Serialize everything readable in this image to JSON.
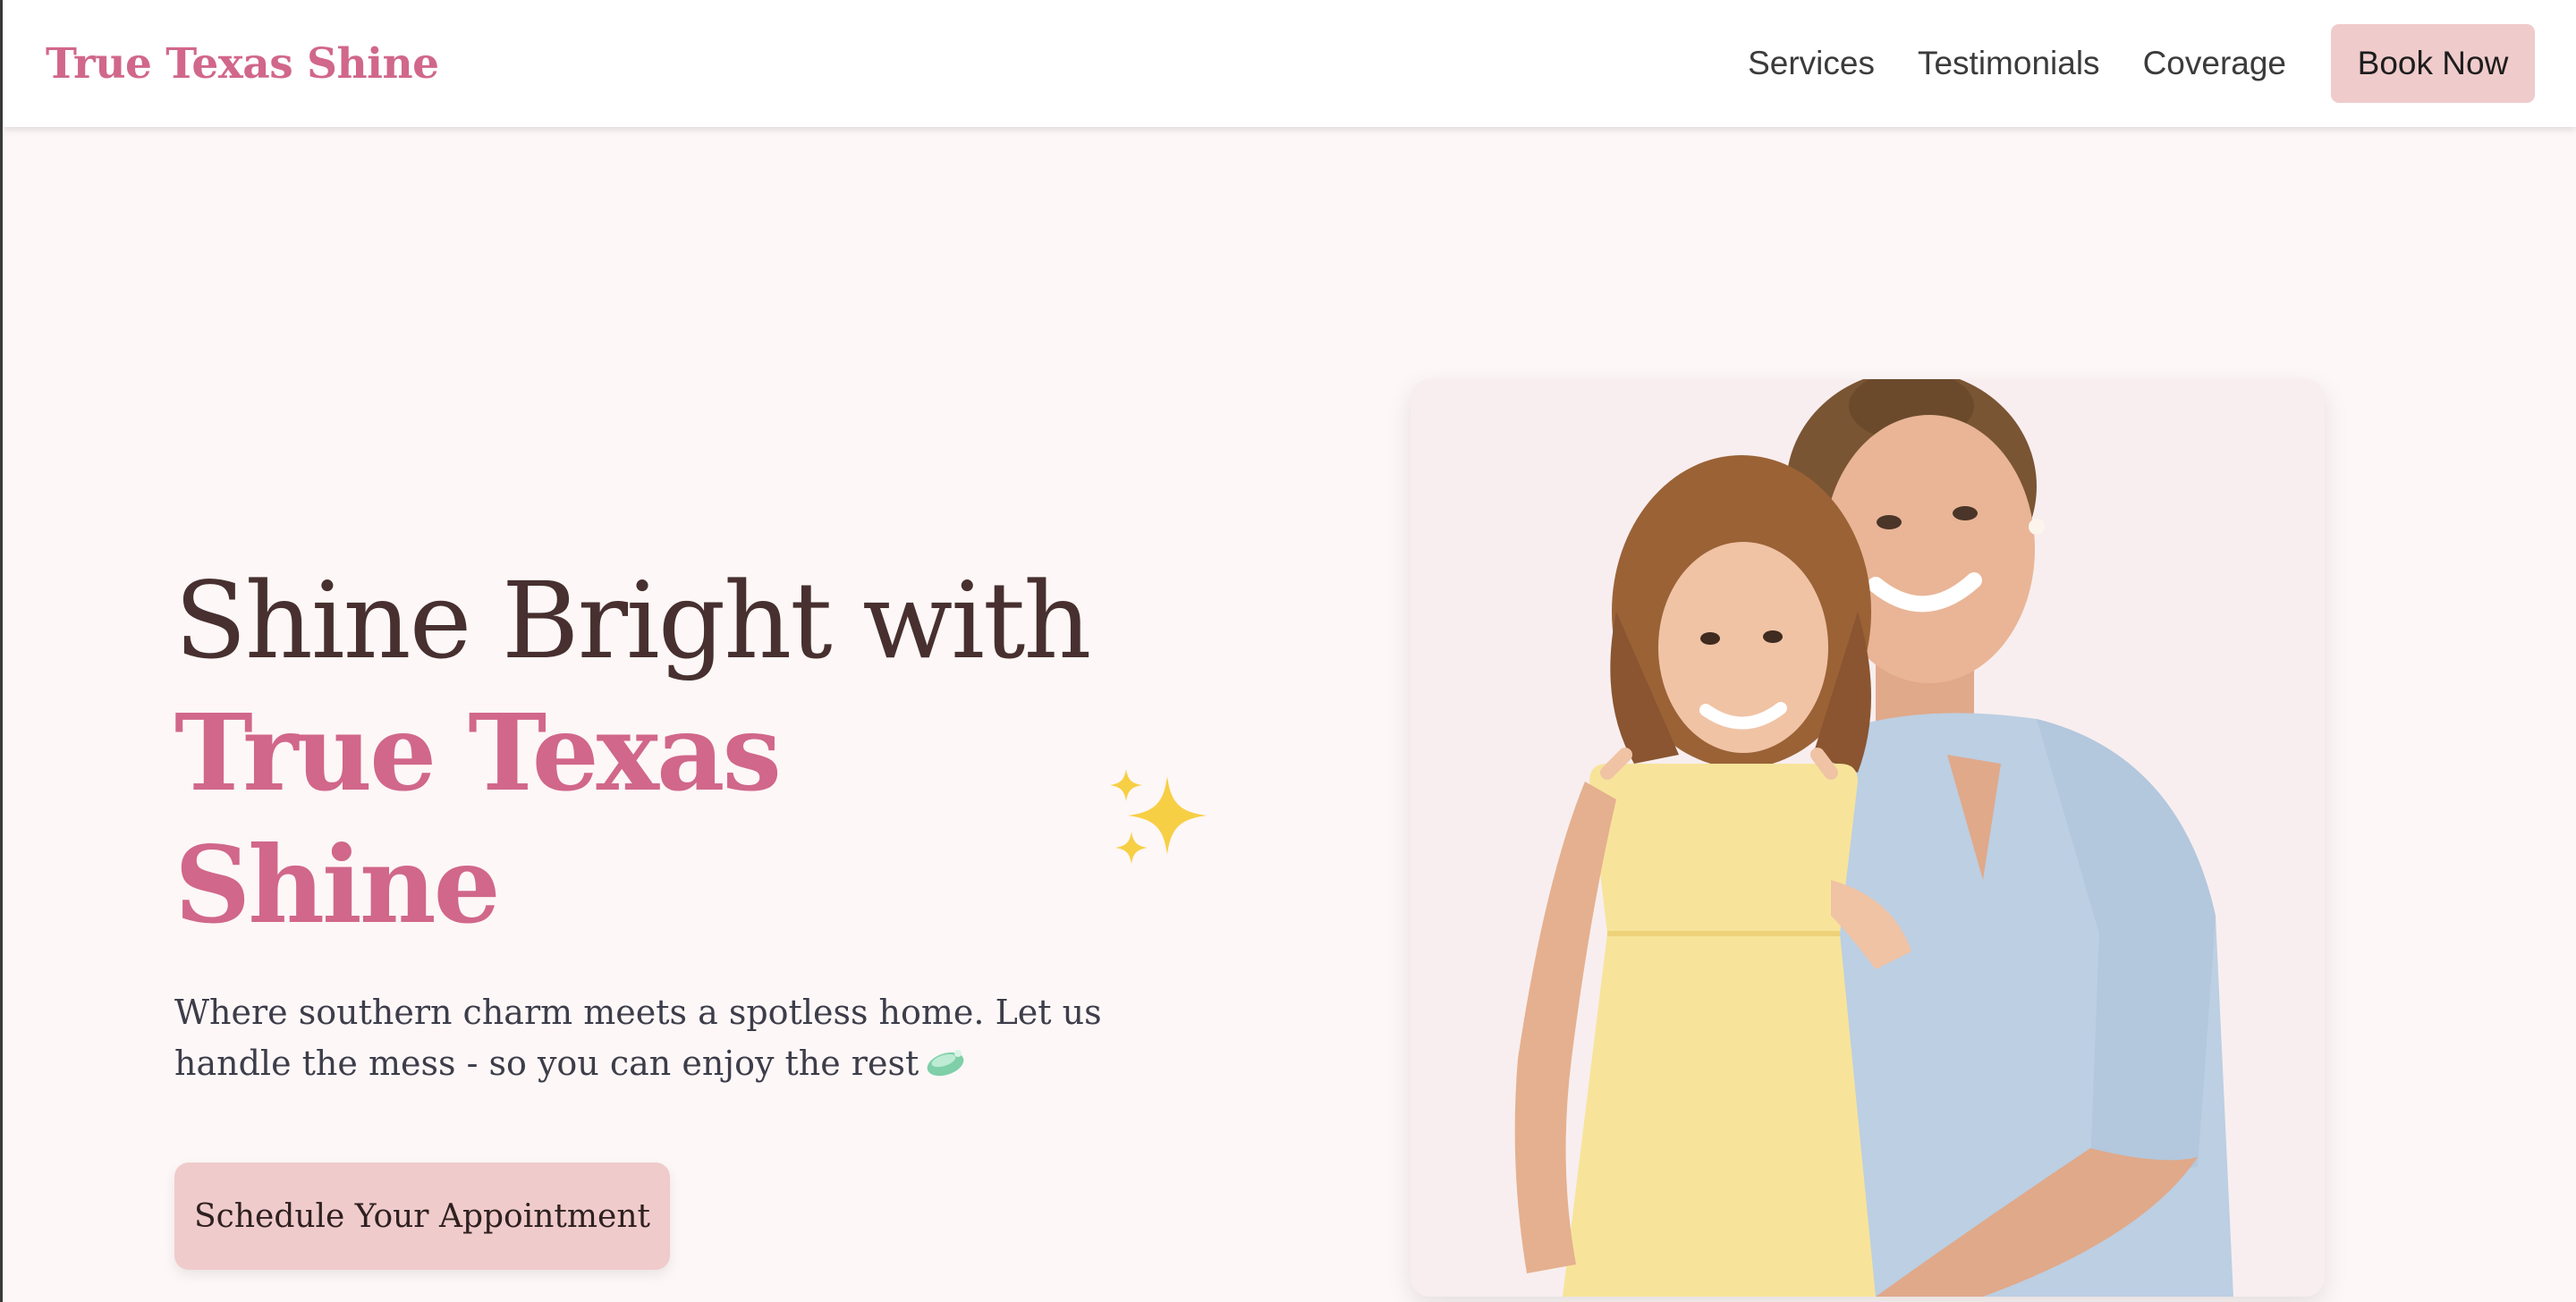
{
  "header": {
    "brand": "True Texas Shine",
    "nav": [
      "Services",
      "Testimonials",
      "Coverage"
    ],
    "book_label": "Book Now"
  },
  "hero": {
    "headline_line1": "Shine Bright with",
    "headline_line2": "True Texas Shine",
    "subtext": "Where southern charm meets a spotless home. Let us handle the mess - so you can enjoy the rest",
    "cta_label": "Schedule Your Appointment"
  },
  "colors": {
    "brand_pink": "#d1678b",
    "button_pink": "#f0cbcb",
    "heading_brown": "#47302f",
    "page_bg": "#fdf7f7"
  },
  "icons": {
    "headline_emoji": "sparkles-icon",
    "subtext_emoji": "soap-icon"
  }
}
